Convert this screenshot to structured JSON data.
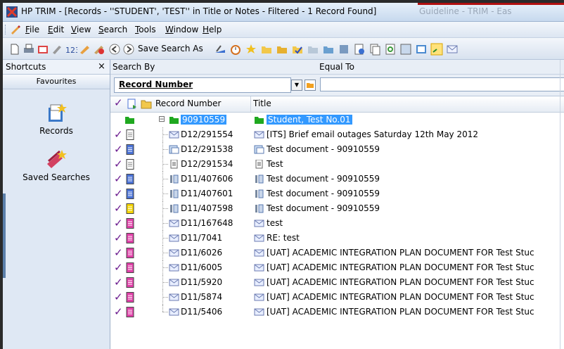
{
  "window": {
    "title": "HP TRIM - [Records - ''STUDENT', 'TEST'' in Title or Notes - Filtered - 1 Record Found]",
    "ghost_text": "Guideline - TRIM - Eas"
  },
  "menu": [
    {
      "label": "File",
      "key": "F"
    },
    {
      "label": "Edit",
      "key": "E"
    },
    {
      "label": "View",
      "key": "V"
    },
    {
      "label": "Search",
      "key": "S"
    },
    {
      "label": "Tools",
      "key": "T"
    },
    {
      "label": "Window",
      "key": "W"
    },
    {
      "label": "Help",
      "key": "H"
    }
  ],
  "toolbar": {
    "save_search_label": "Save Search As"
  },
  "shortcuts": {
    "header": "Shortcuts",
    "close": "×",
    "favourites": "Favourites",
    "items": [
      {
        "label": "Records",
        "icon": "records-icon"
      },
      {
        "label": "Saved Searches",
        "icon": "saved-searches-icon"
      }
    ]
  },
  "search": {
    "search_by_label": "Search By",
    "equal_to_label": "Equal To",
    "field": "Record Number",
    "value": ""
  },
  "grid": {
    "columns": [
      "Record Number",
      "Title"
    ],
    "rows": [
      {
        "number": "90910559",
        "title": "Student, Test No.01",
        "type": "folder",
        "selected": true
      },
      {
        "number": "D12/291554",
        "title": "[ITS] Brief email outages Saturday 12th May 2012",
        "type": "email",
        "doc": "white"
      },
      {
        "number": "D12/291538",
        "title": "Test document - 90910559",
        "type": "scan",
        "doc": "blue"
      },
      {
        "number": "D12/291534",
        "title": "Test",
        "type": "text",
        "doc": "white"
      },
      {
        "number": "D11/407606",
        "title": "Test document - 90910559",
        "type": "paper",
        "doc": "blue"
      },
      {
        "number": "D11/407601",
        "title": "Test document - 90910559",
        "type": "paper",
        "doc": "blue"
      },
      {
        "number": "D11/407598",
        "title": "Test document - 90910559",
        "type": "paper",
        "doc": "yellow"
      },
      {
        "number": "D11/167648",
        "title": "test",
        "type": "email",
        "doc": "pink"
      },
      {
        "number": "D11/7041",
        "title": "RE: test",
        "type": "email",
        "doc": "pink"
      },
      {
        "number": "D11/6026",
        "title": "[UAT] ACADEMIC INTEGRATION PLAN DOCUMENT FOR Test Stuc",
        "type": "email",
        "doc": "pink"
      },
      {
        "number": "D11/6005",
        "title": "[UAT] ACADEMIC INTEGRATION PLAN DOCUMENT FOR Test Stuc",
        "type": "email",
        "doc": "pink"
      },
      {
        "number": "D11/5920",
        "title": "[UAT] ACADEMIC INTEGRATION PLAN DOCUMENT FOR Test Stuc",
        "type": "email",
        "doc": "pink"
      },
      {
        "number": "D11/5874",
        "title": "[UAT] ACADEMIC INTEGRATION PLAN DOCUMENT FOR Test Stuc",
        "type": "email",
        "doc": "pink"
      },
      {
        "number": "D11/5406",
        "title": "[UAT] ACADEMIC INTEGRATION PLAN DOCUMENT FOR Test Stuc",
        "type": "email",
        "doc": "pink"
      }
    ]
  },
  "colors": {
    "selection": "#3399ff",
    "check": "#6b1c8f",
    "folder": "#1fa81f",
    "doc_white": "#ffffff",
    "doc_blue": "#4a72d6",
    "doc_yellow": "#f5d400",
    "doc_pink": "#e040a8"
  }
}
